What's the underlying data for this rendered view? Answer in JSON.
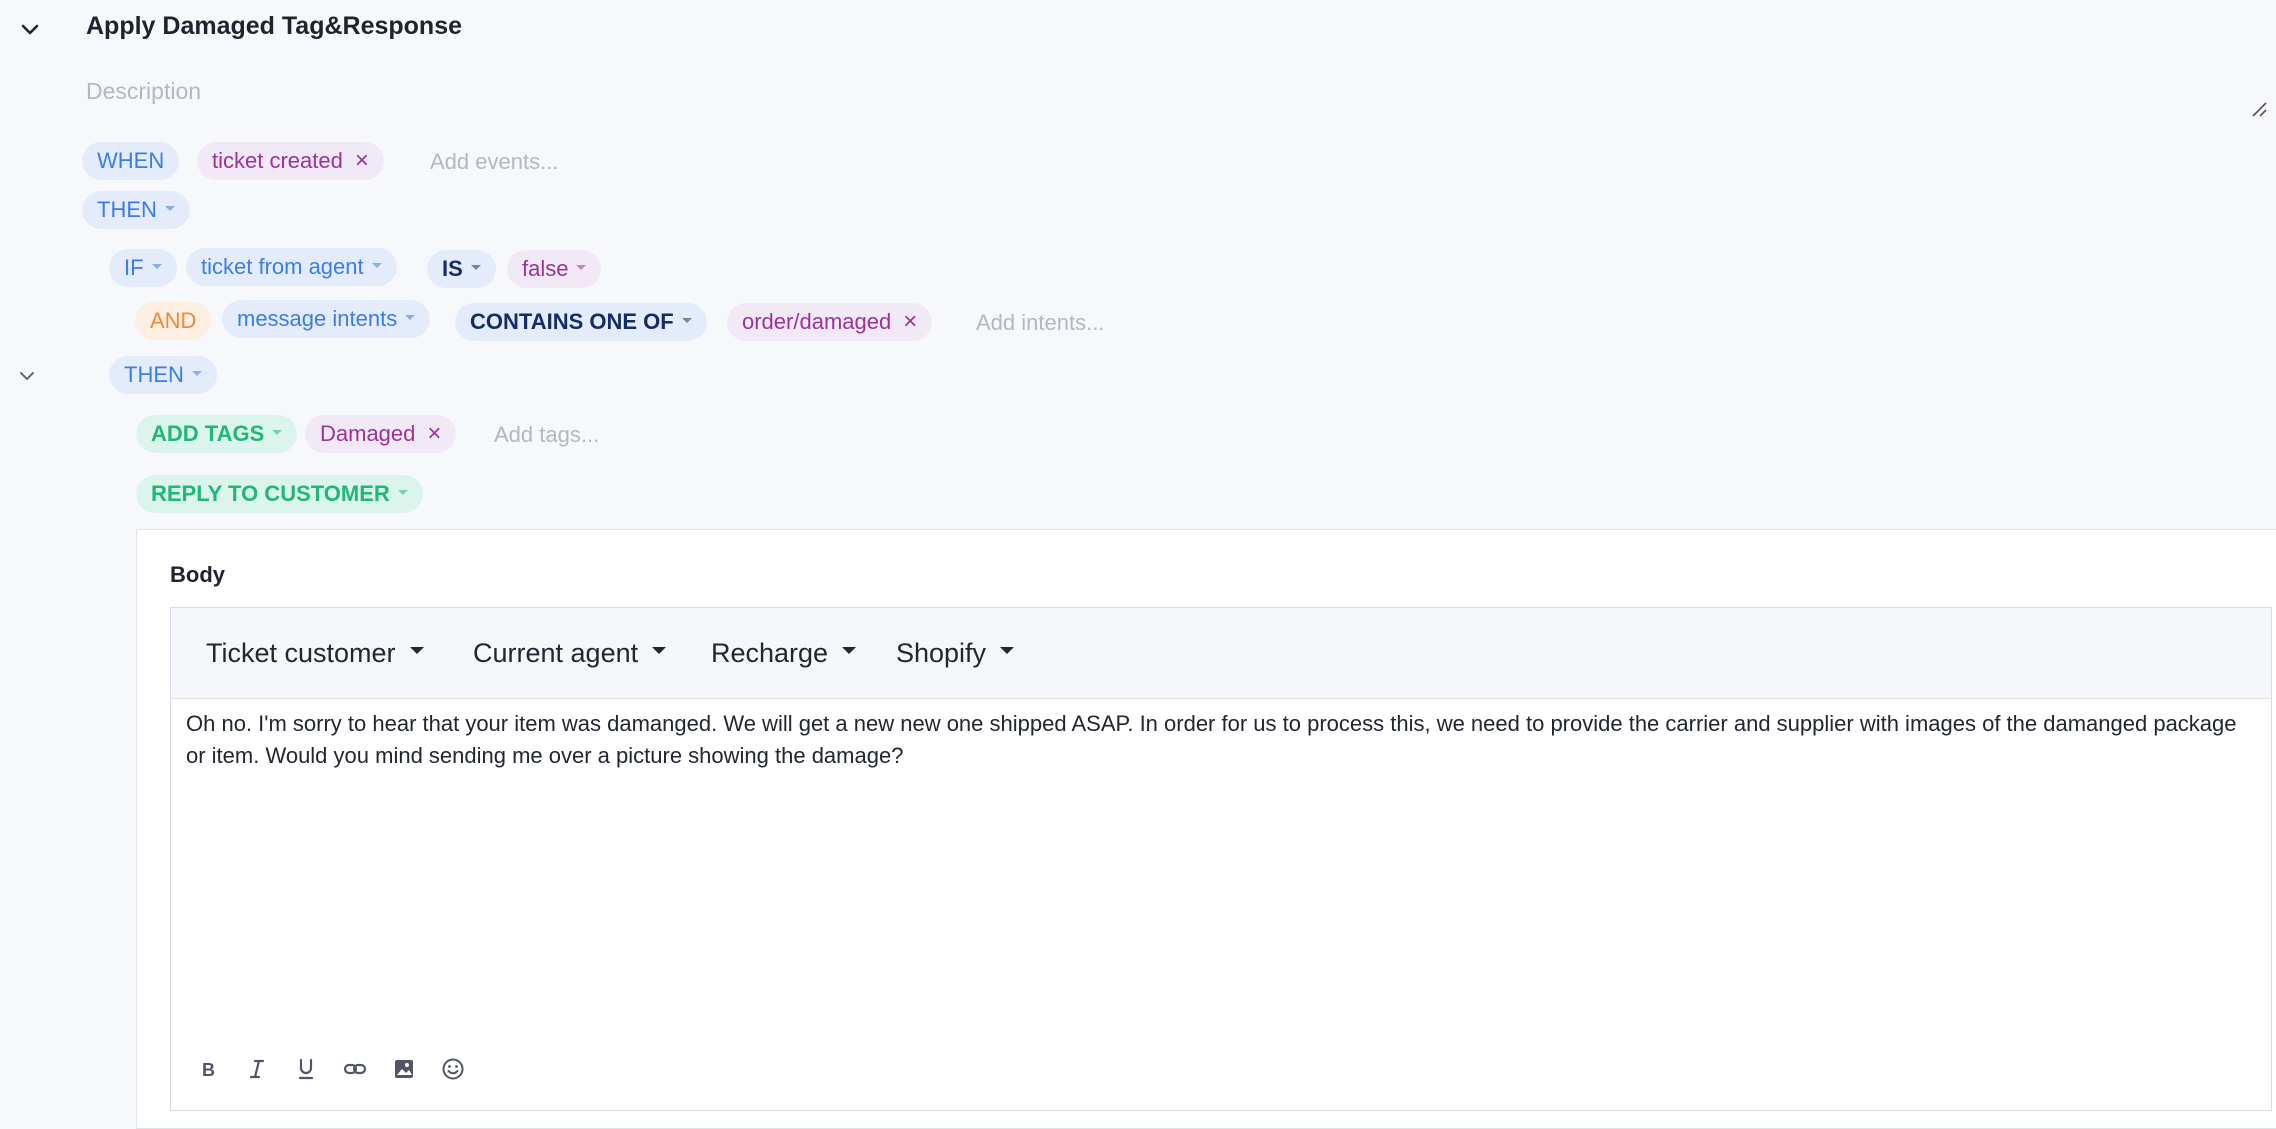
{
  "rule": {
    "title": "Apply Damaged Tag&Response",
    "description_placeholder": "Description"
  },
  "when": {
    "label": "WHEN",
    "event": "ticket created",
    "add_placeholder": "Add events..."
  },
  "then_root": {
    "label": "THEN"
  },
  "condition": {
    "if_label": "IF",
    "field": "ticket from agent",
    "operator": "IS",
    "value": "false",
    "and_label": "AND",
    "and_field": "message intents",
    "and_operator": "CONTAINS ONE OF",
    "and_value": "order/damaged",
    "and_placeholder": "Add intents..."
  },
  "then_branch": {
    "label": "THEN"
  },
  "actions": {
    "add_tags_label": "ADD TAGS",
    "tag": "Damaged",
    "tags_placeholder": "Add tags...",
    "reply_label": "REPLY TO CUSTOMER"
  },
  "reply": {
    "body_label": "Body",
    "toolbar": [
      "Ticket customer",
      "Current agent",
      "Recharge",
      "Shopify"
    ],
    "body_text": "Oh no. I'm sorry to hear that your item was damanged. We will get a new new one shipped ASAP. In order for us to process this, we need to provide the carrier and supplier with images of the damanged package or item. Would you mind sending me over a picture showing the damage?"
  },
  "icons": {
    "collapse": "chevron-down-icon",
    "format": [
      "bold-icon",
      "italic-icon",
      "underline-icon",
      "link-icon",
      "image-icon",
      "emoji-icon"
    ]
  },
  "colors": {
    "background": "#f7f8fc",
    "blue_pill": "#3b7de8",
    "purple_pill": "#9c329c",
    "green_pill": "#21b877",
    "orange_pill": "#f0883a"
  }
}
